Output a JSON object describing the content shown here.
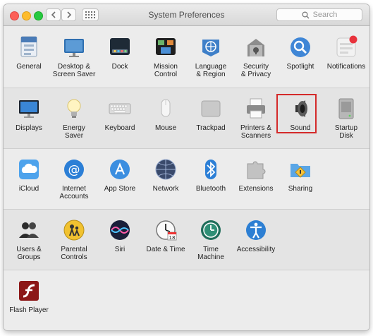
{
  "window": {
    "title": "System Preferences",
    "search_placeholder": "Search"
  },
  "rows": [
    {
      "items": [
        {
          "name": "general",
          "label": "General",
          "icon": "general-icon"
        },
        {
          "name": "desktop-screen-saver",
          "label": "Desktop &\nScreen Saver",
          "icon": "desktop-screen-saver-icon"
        },
        {
          "name": "dock",
          "label": "Dock",
          "icon": "dock-icon"
        },
        {
          "name": "mission-control",
          "label": "Mission\nControl",
          "icon": "mission-control-icon"
        },
        {
          "name": "language-region",
          "label": "Language\n& Region",
          "icon": "language-region-icon"
        },
        {
          "name": "security-privacy",
          "label": "Security\n& Privacy",
          "icon": "security-privacy-icon"
        },
        {
          "name": "spotlight",
          "label": "Spotlight",
          "icon": "spotlight-icon"
        },
        {
          "name": "notifications",
          "label": "Notifications",
          "icon": "notifications-icon"
        }
      ]
    },
    {
      "items": [
        {
          "name": "displays",
          "label": "Displays",
          "icon": "displays-icon"
        },
        {
          "name": "energy-saver",
          "label": "Energy\nSaver",
          "icon": "energy-saver-icon"
        },
        {
          "name": "keyboard",
          "label": "Keyboard",
          "icon": "keyboard-icon"
        },
        {
          "name": "mouse",
          "label": "Mouse",
          "icon": "mouse-icon"
        },
        {
          "name": "trackpad",
          "label": "Trackpad",
          "icon": "trackpad-icon"
        },
        {
          "name": "printers-scanners",
          "label": "Printers &\nScanners",
          "icon": "printers-scanners-icon"
        },
        {
          "name": "sound",
          "label": "Sound",
          "icon": "sound-icon",
          "highlighted": true
        },
        {
          "name": "startup-disk",
          "label": "Startup\nDisk",
          "icon": "startup-disk-icon"
        }
      ]
    },
    {
      "items": [
        {
          "name": "icloud",
          "label": "iCloud",
          "icon": "icloud-icon"
        },
        {
          "name": "internet-accounts",
          "label": "Internet\nAccounts",
          "icon": "internet-accounts-icon"
        },
        {
          "name": "app-store",
          "label": "App Store",
          "icon": "app-store-icon"
        },
        {
          "name": "network",
          "label": "Network",
          "icon": "network-icon"
        },
        {
          "name": "bluetooth",
          "label": "Bluetooth",
          "icon": "bluetooth-icon"
        },
        {
          "name": "extensions",
          "label": "Extensions",
          "icon": "extensions-icon"
        },
        {
          "name": "sharing",
          "label": "Sharing",
          "icon": "sharing-icon"
        }
      ]
    },
    {
      "items": [
        {
          "name": "users-groups",
          "label": "Users &\nGroups",
          "icon": "users-groups-icon"
        },
        {
          "name": "parental-controls",
          "label": "Parental\nControls",
          "icon": "parental-controls-icon"
        },
        {
          "name": "siri",
          "label": "Siri",
          "icon": "siri-icon"
        },
        {
          "name": "date-time",
          "label": "Date & Time",
          "icon": "date-time-icon"
        },
        {
          "name": "time-machine",
          "label": "Time\nMachine",
          "icon": "time-machine-icon"
        },
        {
          "name": "accessibility",
          "label": "Accessibility",
          "icon": "accessibility-icon"
        }
      ]
    },
    {
      "items": [
        {
          "name": "flash-player",
          "label": "Flash Player",
          "icon": "flash-player-icon"
        }
      ]
    }
  ],
  "colors": {
    "highlight_border": "#d42a2a",
    "close": "#fc5f57",
    "minimize": "#fdbc2e",
    "zoom": "#27c940"
  }
}
